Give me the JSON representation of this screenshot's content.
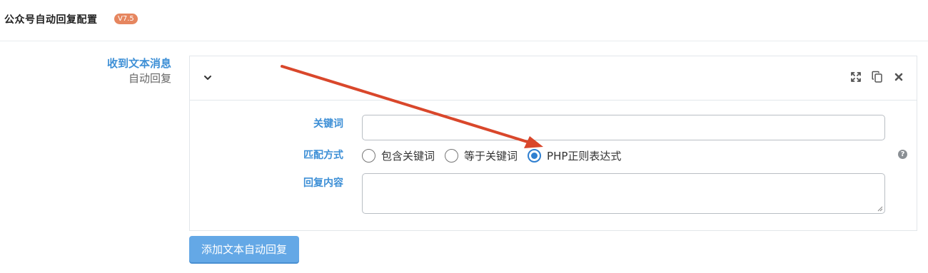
{
  "header": {
    "title": "公众号自动回复配置",
    "version_badge": "V7.5"
  },
  "section": {
    "title": "收到文本消息",
    "subtitle": "自动回复"
  },
  "panel": {
    "collapse_icon": "chevron-down-icon",
    "tools": [
      "expand-icon",
      "copy-icon",
      "close-icon"
    ]
  },
  "form": {
    "keyword_label": "关键词",
    "keyword_value": "",
    "match_label": "匹配方式",
    "match_options": [
      "包含关键词",
      "等于关键词",
      "PHP正则表达式"
    ],
    "match_selected": "PHP正则表达式",
    "reply_label": "回复内容",
    "reply_value": "",
    "help_icon": "question-circle-icon"
  },
  "actions": {
    "add_button": "添加文本自动回复"
  },
  "colors": {
    "accent": "#3d8fd6",
    "badge": "#e6865f",
    "arrow": "#d9472b",
    "button": "#64a8e6"
  }
}
